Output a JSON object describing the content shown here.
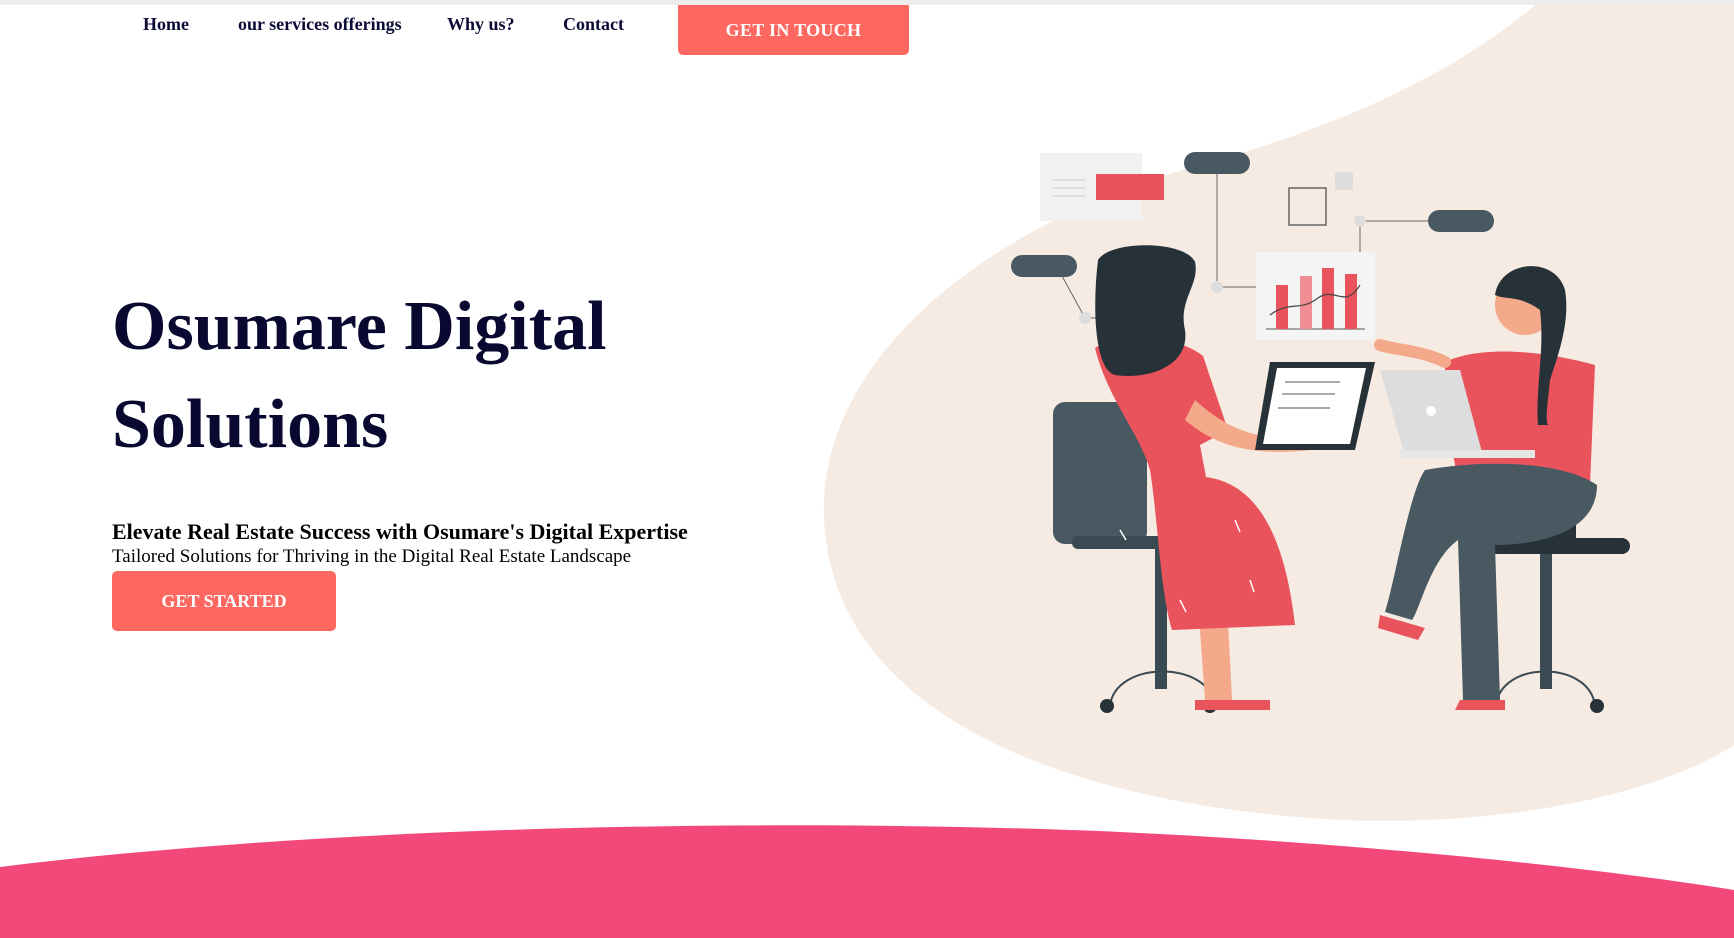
{
  "nav": {
    "links": [
      {
        "label": "Home"
      },
      {
        "label": "our services offerings"
      },
      {
        "label": "Why us?"
      },
      {
        "label": "Contact"
      }
    ],
    "cta_label": "GET IN TOUCH"
  },
  "hero": {
    "title_line1": "Osumare Digital",
    "title_line2": "Solutions",
    "subtitle": "Elevate Real Estate Success with Osumare's Digital Expertise",
    "tagline": "Tailored Solutions for Thriving in the Digital Real Estate Landscape",
    "cta_label": "GET STARTED"
  },
  "colors": {
    "accent": "#ff6761",
    "heading": "#080830",
    "nav_text": "#0b0b35",
    "blob": "#f6ebe3",
    "footer_wave": "#f2497a"
  },
  "illustration": {
    "icon": "two-women-meeting-illustration"
  }
}
